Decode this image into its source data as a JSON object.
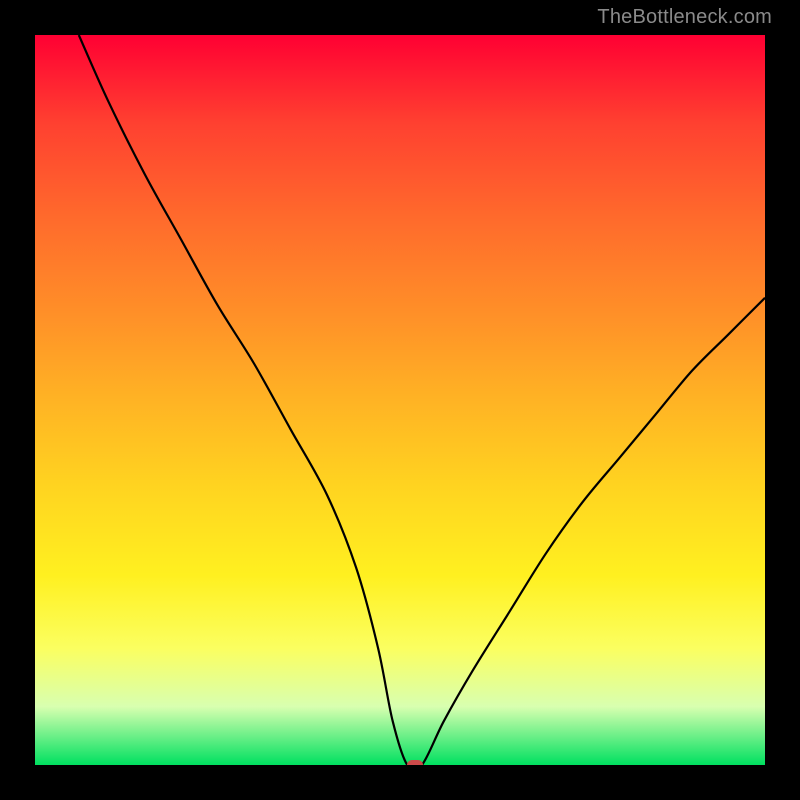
{
  "watermark": "TheBottleneck.com",
  "chart_data": {
    "type": "line",
    "title": "",
    "xlabel": "",
    "ylabel": "",
    "xlim": [
      0,
      100
    ],
    "ylim": [
      0,
      100
    ],
    "grid": false,
    "series": [
      {
        "name": "bottleneck-curve",
        "x": [
          6,
          10,
          15,
          20,
          25,
          30,
          35,
          40,
          44,
          47,
          49,
          51,
          53,
          56,
          60,
          65,
          70,
          75,
          80,
          85,
          90,
          95,
          100
        ],
        "values": [
          100,
          91,
          81,
          72,
          63,
          55,
          46,
          37,
          27,
          16,
          6,
          0,
          0,
          6,
          13,
          21,
          29,
          36,
          42,
          48,
          54,
          59,
          64
        ]
      }
    ],
    "markers": [
      {
        "name": "bottleneck-point",
        "x": 52,
        "y": 0,
        "color": "#cc4a4a"
      }
    ],
    "background_gradient": {
      "stops": [
        {
          "pos": 0,
          "color": "#ff0033"
        },
        {
          "pos": 50,
          "color": "#ffb324"
        },
        {
          "pos": 84,
          "color": "#fbff60"
        },
        {
          "pos": 100,
          "color": "#00e060"
        }
      ]
    }
  }
}
